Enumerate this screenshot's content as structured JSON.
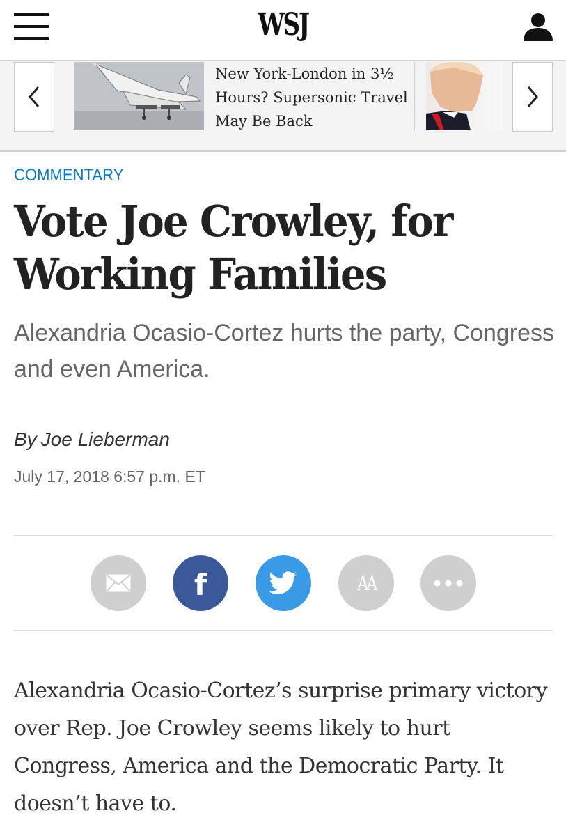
{
  "header": {
    "logo": "WSJ",
    "menu_icon": "hamburger-menu-icon",
    "account_icon": "user-icon"
  },
  "carousel": {
    "prev_icon": "chevron-left-icon",
    "next_icon": "chevron-right-icon",
    "current_headline": "New York-London in 3½ Hours? Supersonic Travel May Be Back"
  },
  "article": {
    "section": "COMMENTARY",
    "title": "Vote Joe Crowley, for Working Families",
    "subtitle": "Alexandria Ocasio-Cortez hurts the party, Congress and even America.",
    "byline_prefix": "By",
    "author": "Joe Lieberman",
    "timestamp": "July 17, 2018 6:57 p.m. ET",
    "body": "Alexandria Ocasio-Cortez’s surprise primary victory over Rep. Joe Crowley seems likely to hurt Congress, America and the Democratic Party. It doesn’t have to."
  },
  "share": {
    "email_icon": "envelope-icon",
    "facebook_label": "f",
    "twitter_icon": "twitter-bird-icon",
    "textsize_label": "AA",
    "more_icon": "ellipsis-icon"
  },
  "colors": {
    "section_accent": "#0a7bbd",
    "facebook": "#3b5998",
    "twitter": "#3a9ae6",
    "share_gray": "#cfcfcf"
  }
}
